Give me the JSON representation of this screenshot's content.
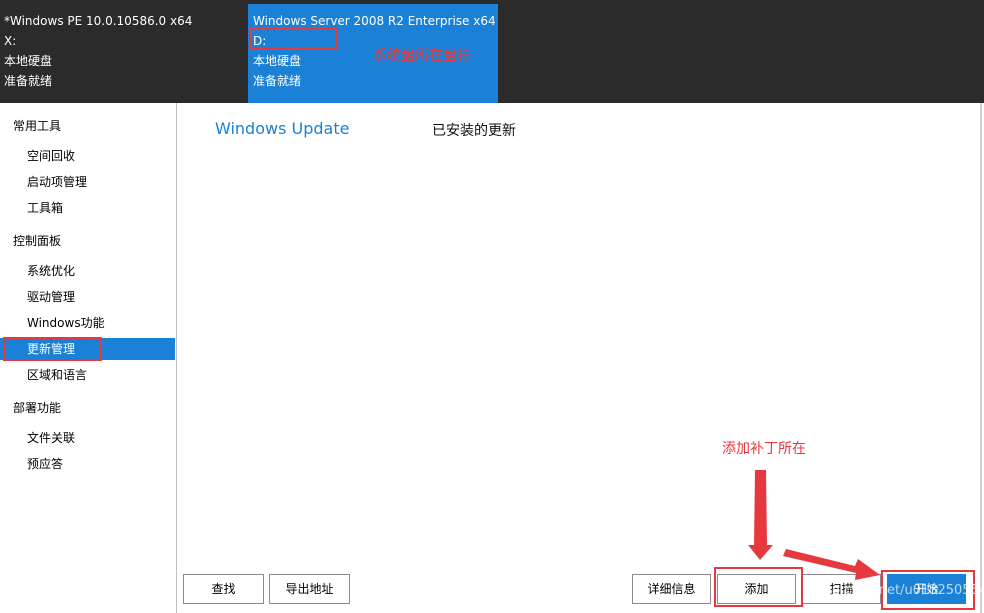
{
  "os_list": [
    {
      "name": "*Windows PE 10.0.10586.0 x64",
      "drive": "X:",
      "disk_type": "本地硬盘",
      "status": "准备就绪"
    },
    {
      "name": "Windows Server 2008 R2 Enterprise x64",
      "drive": "D:",
      "disk_type": "本地硬盘",
      "status": "准备就绪"
    }
  ],
  "sidebar": {
    "groups": [
      {
        "title": "常用工具",
        "items": [
          "空间回收",
          "启动项管理",
          "工具箱"
        ]
      },
      {
        "title": "控制面板",
        "items": [
          "系统优化",
          "驱动管理",
          "Windows功能",
          "更新管理",
          "区域和语言"
        ]
      },
      {
        "title": "部署功能",
        "items": [
          "文件关联",
          "预应答"
        ]
      }
    ],
    "active_item": "更新管理"
  },
  "main": {
    "tabs": {
      "windows_update": "Windows Update",
      "installed_updates": "已安装的更新"
    }
  },
  "buttons": {
    "find": "查找",
    "export_address": "导出地址",
    "details": "详细信息",
    "add": "添加",
    "scan": "扫描",
    "primary": "开始"
  },
  "annotations": {
    "system_drive": "系统盘所在盘符",
    "add_patch": "添加补丁所在"
  },
  "watermark": "blog.csdn.net/u013250554",
  "colors": {
    "accent": "#1a81d6",
    "topbar": "#2b2b2b",
    "annotation_red": "#e6393f"
  }
}
